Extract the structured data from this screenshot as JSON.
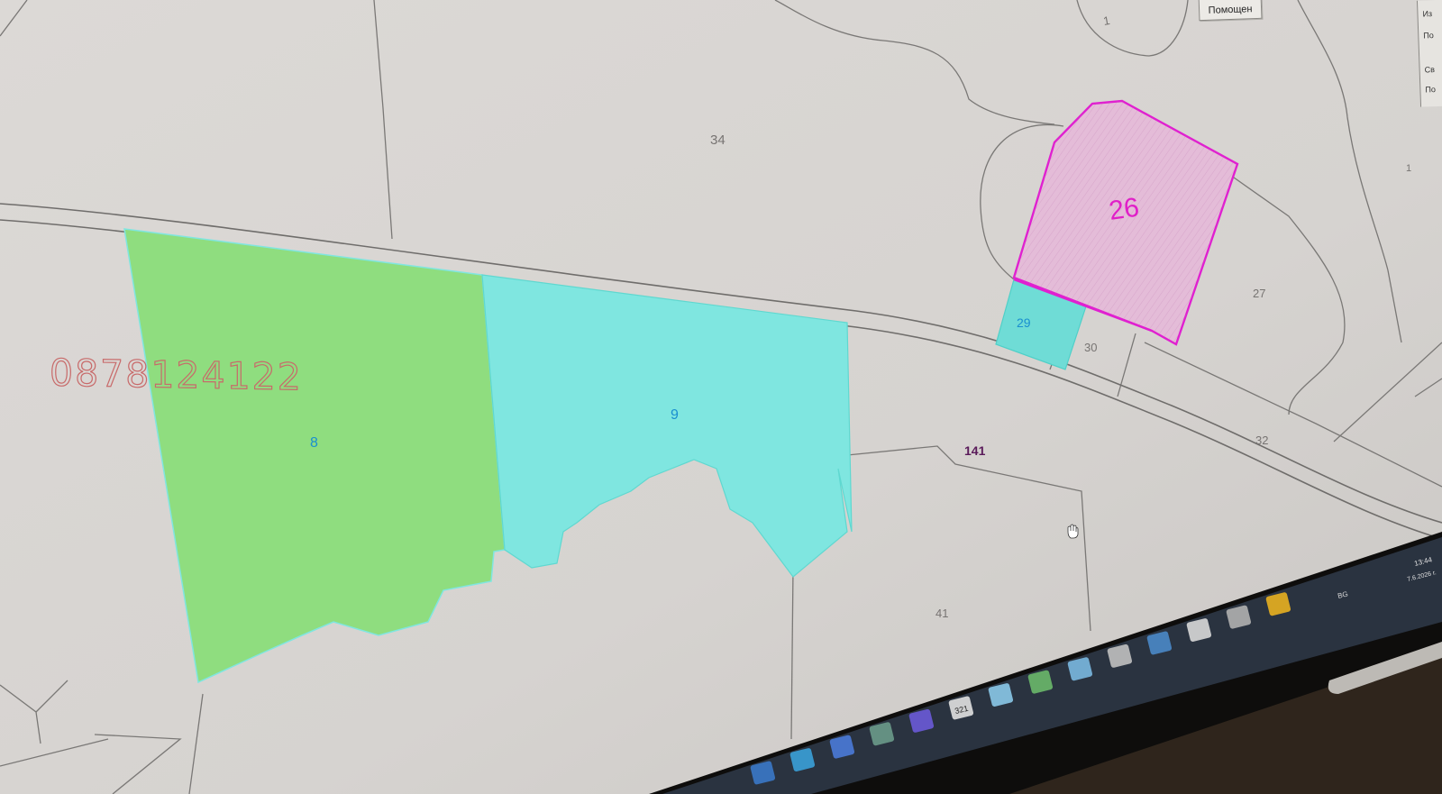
{
  "map": {
    "parcels": [
      {
        "id": "8",
        "fill": "#8fdd7f"
      },
      {
        "id": "9",
        "fill": "#7fe6e0"
      },
      {
        "id": "26",
        "fill": "#e4bcd8",
        "stroke": "#e020d0"
      },
      {
        "id": "29",
        "fill": "#6fdcd6"
      }
    ],
    "labels": {
      "p1_top": "1",
      "p1_right": "1",
      "p34": "34",
      "p8": "8",
      "p9": "9",
      "p26": "26",
      "p29": "29",
      "p30": "30",
      "p27": "27",
      "p32": "32",
      "p141": "141",
      "p41": "41"
    },
    "colors": {
      "background": "#d9d6d3",
      "boundary": "#7a7876",
      "label_blue": "#1a8fd0",
      "label_magenta": "#e020c8",
      "label_purple": "#5a1a5a",
      "label_gray": "#777472"
    }
  },
  "watermark": {
    "phone": "0878124122",
    "color": "#c86a6a"
  },
  "dialog": {
    "help_button": "Помощен"
  },
  "side_panel": {
    "items": [
      "Из",
      "По",
      "Св",
      "По"
    ]
  },
  "taskbar": {
    "icons": [
      "ie-icon",
      "globe-icon",
      "calculator-grid-icon",
      "cad-app-icon",
      "viber-icon",
      "calendar-icon",
      "document-icon",
      "network-tool-icon",
      "spreadsheet-icon",
      "pen-tool-icon",
      "chrome-icon",
      "printer-icon",
      "settings-gear-icon",
      "warning-icon"
    ],
    "calendar_badge": "321",
    "tray": {
      "language": "BG",
      "time": "13:44",
      "date": "7.6.2026 г."
    }
  }
}
